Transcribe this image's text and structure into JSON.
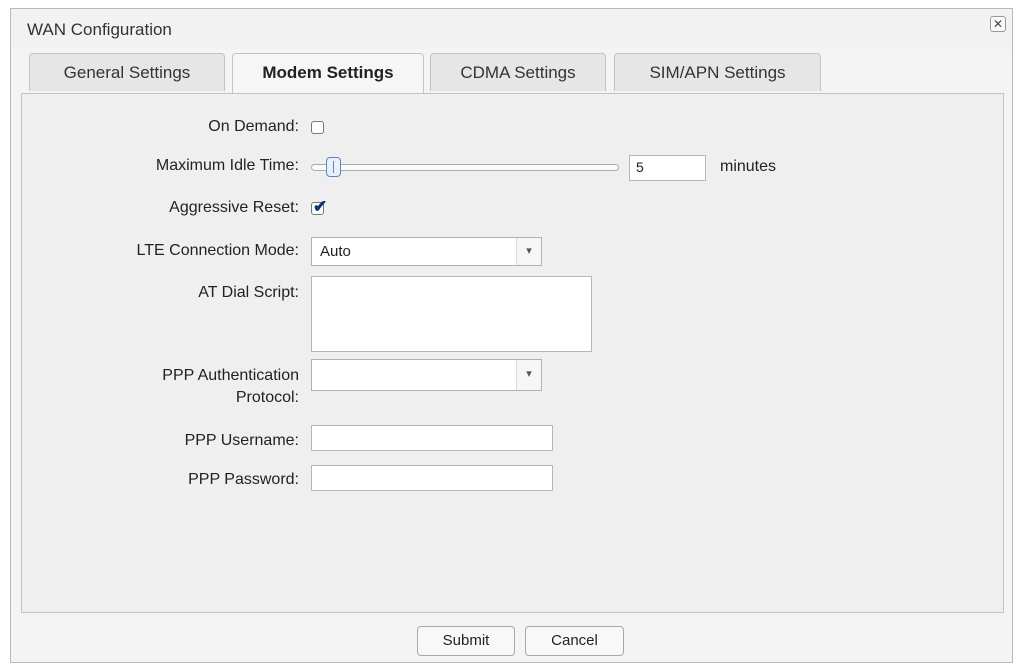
{
  "dialog": {
    "title": "WAN Configuration",
    "close_glyph": "✕"
  },
  "tabs": [
    {
      "label": "General Settings"
    },
    {
      "label": "Modem Settings",
      "active": true
    },
    {
      "label": "CDMA Settings"
    },
    {
      "label": "SIM/APN Settings"
    }
  ],
  "form": {
    "on_demand": {
      "label": "On Demand:",
      "checked": false
    },
    "max_idle": {
      "label": "Maximum Idle Time:",
      "value": "5",
      "unit": "minutes",
      "slider_level": 0.05
    },
    "aggressive_reset": {
      "label": "Aggressive Reset:",
      "checked": true
    },
    "lte_mode": {
      "label": "LTE Connection Mode:",
      "value": "Auto"
    },
    "at_dial": {
      "label": "AT Dial Script:",
      "value": ""
    },
    "ppp_auth": {
      "label_line1": "PPP Authentication",
      "label_line2": "Protocol:",
      "value": ""
    },
    "ppp_username": {
      "label": "PPP Username:",
      "value": ""
    },
    "ppp_password": {
      "label": "PPP Password:",
      "value": ""
    }
  },
  "footer": {
    "submit_label": "Submit",
    "cancel_label": "Cancel"
  },
  "icons": {
    "checkmark": "✔",
    "dropdown": "▾"
  },
  "colors": {
    "accent": "#0d2e70",
    "slider_handle": "#5a86bb"
  }
}
